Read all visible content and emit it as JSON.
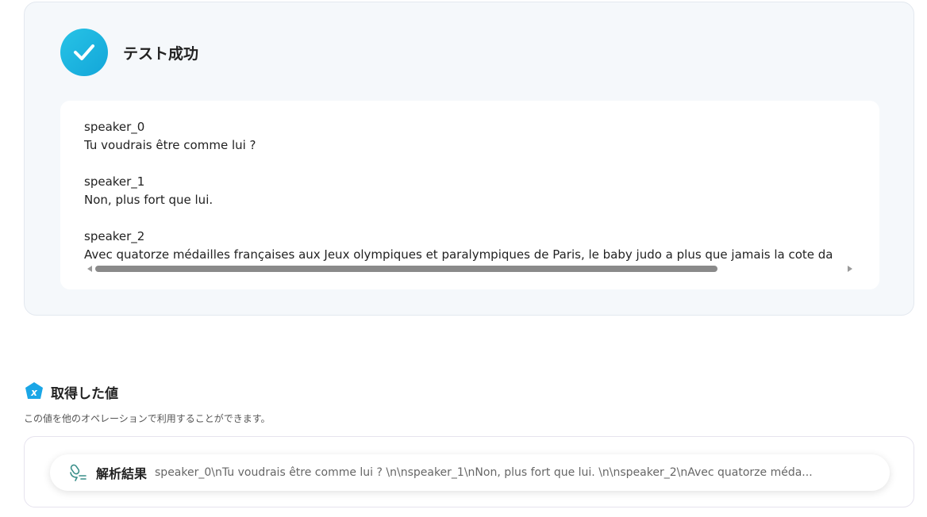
{
  "success": {
    "title": "テスト成功",
    "icon": "check-icon",
    "accent": "#1fb6e0",
    "lines": [
      "speaker_0",
      "Tu voudrais être comme lui ?",
      "",
      "speaker_1",
      "Non, plus fort que lui.",
      "",
      "speaker_2",
      "Avec quatorze médailles françaises aux Jeux olympiques et paralympiques de Paris, le baby judo a plus que jamais la cote da"
    ]
  },
  "acquired": {
    "title": "取得した値",
    "description": "この値を他のオペレーションで利用することができます。",
    "icon": "variable-icon",
    "icon_color": "#1aa6e6",
    "items": [
      {
        "label": "解析結果",
        "icon": "microphone-icon",
        "value": "speaker_0\\nTu voudrais être comme lui ? \\n\\nspeaker_1\\nNon, plus fort que lui. \\n\\nspeaker_2\\nAvec quatorze méda..."
      }
    ]
  }
}
